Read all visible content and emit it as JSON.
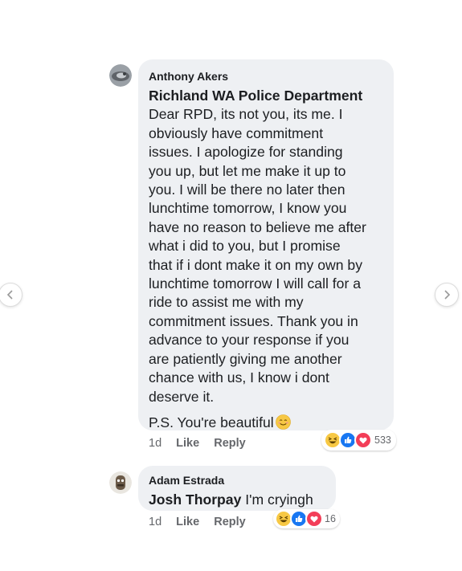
{
  "comments": [
    {
      "author": "Anthony Akers",
      "tag": "Richland WA Police Department",
      "lines": [
        "Dear RPD, its not you, its me. I",
        "obviously have commitment",
        "issues. I apologize for standing",
        "you up, but let me make it up to",
        "you. I will be there no later then",
        "lunchtime tomorrow, I know you",
        "have no reason to believe me after",
        "what i did to you, but I promise",
        "that if i dont make it on my own by",
        "lunchtime tomorrow I will call for a",
        "ride to assist me with my",
        "commitment issues. Thank you in",
        "advance to your response if you",
        "are patiently giving me another",
        "chance with us, I know i dont",
        "deserve it."
      ],
      "ps": "P.S. You're beautiful",
      "ps_emoji": "smiling-face-icon",
      "time": "1d",
      "like": "Like",
      "reply": "Reply",
      "reactions": [
        "haha-icon",
        "like-icon",
        "love-icon"
      ],
      "reaction_count": "533"
    },
    {
      "author": "Adam Estrada",
      "tag": "Josh Thorpay",
      "text": "I'm cryingh",
      "time": "1d",
      "like": "Like",
      "reply": "Reply",
      "reactions": [
        "haha-icon",
        "like-icon",
        "love-icon"
      ],
      "reaction_count": "16"
    }
  ],
  "colors": {
    "bubble": "#eef0f3",
    "meta": "#65676b",
    "like_blue": "#1877f2",
    "love_red": "#f33e58",
    "haha_yellow": "#f7c844"
  }
}
